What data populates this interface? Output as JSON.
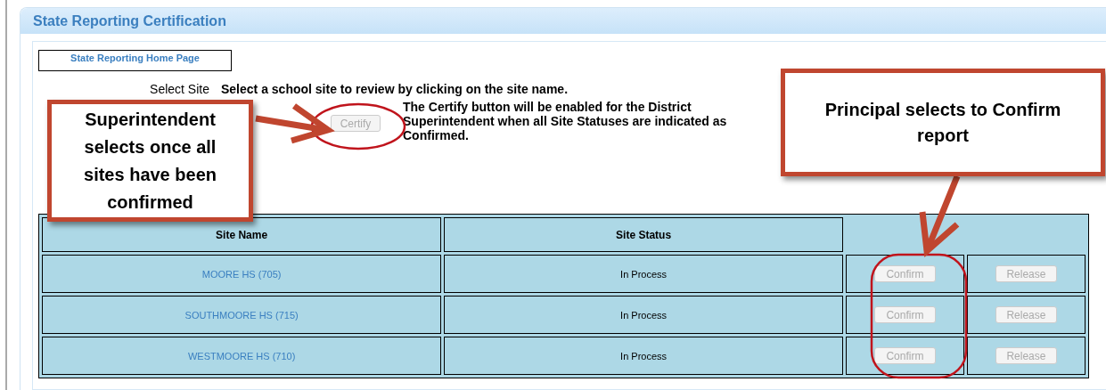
{
  "panel": {
    "title": "State Reporting Certification"
  },
  "home_link": "State Reporting Home Page",
  "select_site": {
    "label": "Select Site",
    "instruction": "Select a school site to review by clicking on the site name."
  },
  "certify_button": {
    "label": "Certify",
    "disabled": true
  },
  "certify_note": "The Certify button will be enabled for the District Superintendent when all Site Statuses are indicated as Confirmed.",
  "table": {
    "columns": [
      "Site Name",
      "Site Status"
    ],
    "rows": [
      {
        "site_name": "MOORE HS (705)",
        "status": "In Process",
        "confirm": {
          "label": "Confirm",
          "disabled": true
        },
        "release": {
          "label": "Release",
          "disabled": true
        }
      },
      {
        "site_name": "SOUTHMOORE HS (715)",
        "status": "In Process",
        "confirm": {
          "label": "Confirm",
          "disabled": true
        },
        "release": {
          "label": "Release",
          "disabled": true
        }
      },
      {
        "site_name": "WESTMOORE HS (710)",
        "status": "In Process",
        "confirm": {
          "label": "Confirm",
          "disabled": true
        },
        "release": {
          "label": "Release",
          "disabled": true
        }
      }
    ]
  },
  "callouts": [
    {
      "text": "Superintendent selects once all sites have been confirmed"
    },
    {
      "text": "Principal selects to Confirm report"
    }
  ]
}
